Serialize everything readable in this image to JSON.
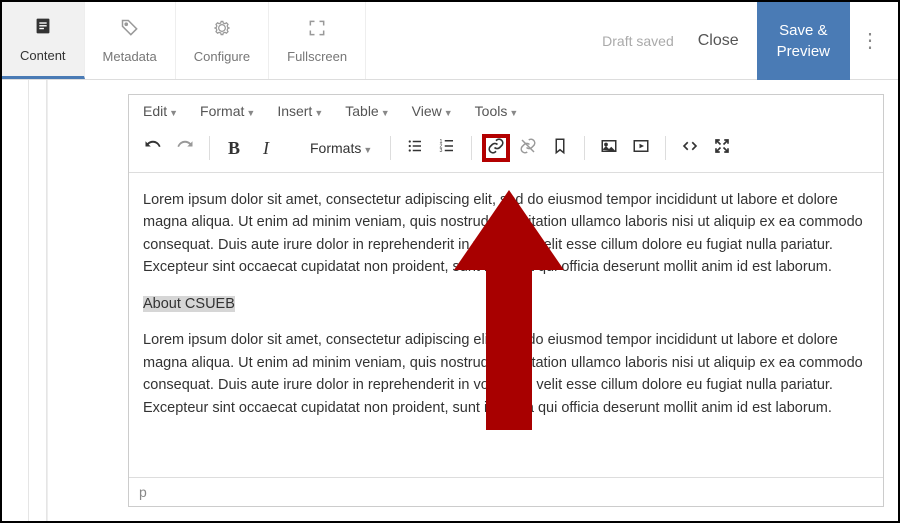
{
  "topbar": {
    "tabs": [
      {
        "label": "Content"
      },
      {
        "label": "Metadata"
      },
      {
        "label": "Configure"
      },
      {
        "label": "Fullscreen"
      }
    ],
    "draft_saved": "Draft saved",
    "close": "Close",
    "save_line1": "Save &",
    "save_line2": "Preview"
  },
  "menubar": {
    "items": [
      "Edit",
      "Format",
      "Insert",
      "Table",
      "View",
      "Tools"
    ]
  },
  "toolbar": {
    "formats_label": "Formats"
  },
  "content": {
    "para1": "Lorem ipsum dolor sit amet, consectetur adipiscing elit, sed do eiusmod tempor incididunt ut labore et dolore magna aliqua. Ut enim ad minim veniam, quis nostrud exercitation ullamco laboris nisi ut aliquip ex ea commodo consequat. Duis aute irure dolor in reprehenderit in voluptate velit esse cillum dolore eu fugiat nulla pariatur. Excepteur sint occaecat cupidatat non proident, sunt in culpa qui officia deserunt mollit anim id est laborum.",
    "link_text": "About CSUEB",
    "para2": "Lorem ipsum dolor sit amet, consectetur adipiscing elit, sed do eiusmod tempor incididunt ut labore et dolore magna aliqua. Ut enim ad minim veniam, quis nostrud exercitation ullamco laboris nisi ut aliquip ex ea commodo consequat. Duis aute irure dolor in reprehenderit in voluptate velit esse cillum dolore eu fugiat nulla pariatur. Excepteur sint occaecat cupidatat non proident, sunt in culpa qui officia deserunt mollit anim id est laborum."
  },
  "statusbar": {
    "path": "p"
  },
  "colors": {
    "accent": "#4a7bb5",
    "annotation": "#b30000"
  }
}
